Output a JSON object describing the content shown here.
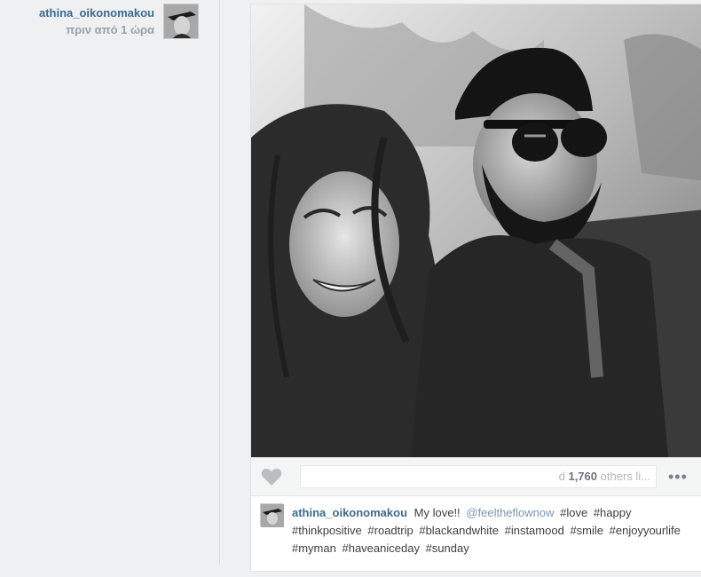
{
  "post": {
    "author": "athina_oikonomakou",
    "time": "πριν από 1 ώρα",
    "likes_prefix": "d",
    "likes_count": "1,760",
    "likes_suffix": "others li...",
    "more_label": "•••",
    "caption": {
      "username": "athina_oikonomakou",
      "text": "My love!!",
      "mention": "@feeltheflownow",
      "hashtags": [
        "#love",
        "#happy",
        "#thinkpositive",
        "#roadtrip",
        "#blackandwhite",
        "#instamood",
        "#smile",
        "#enjoyyourlife",
        "#myman",
        "#haveaniceday",
        "#sunday"
      ]
    }
  },
  "icons": {
    "like": "heart-icon",
    "more": "ellipsis-icon"
  },
  "colors": {
    "username": "#3f6b8f",
    "mention": "#7b97b0",
    "background": "#eef0f1"
  }
}
